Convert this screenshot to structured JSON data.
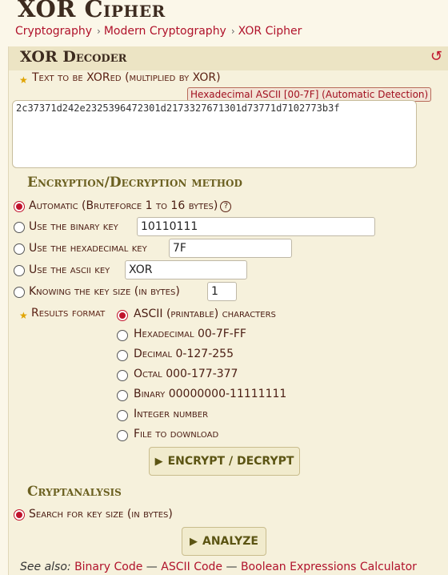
{
  "page": {
    "title": "XOR Cipher",
    "breadcrumb": [
      "Cryptography",
      "Modern Cryptography",
      "XOR Cipher"
    ]
  },
  "decoder": {
    "title": "XOR Decoder",
    "reset_icon": "reset-icon",
    "text_label": "Text to be XORed (multiplied by XOR)",
    "detection_badge": "Hexadecimal ASCII [00-7F] (Automatic Detection)",
    "text_value": "2c37371d242e2325396472301d2173327671301d73771d7102773b3f",
    "method": {
      "heading": "Encryption/Decryption method",
      "options": [
        {
          "label": "Automatic (Bruteforce 1 to 16 bytes)",
          "selected": true
        },
        {
          "label": "Use the binary key",
          "value": "10110111",
          "selected": false
        },
        {
          "label": "Use the hexadecimal key",
          "value": "7F",
          "selected": false
        },
        {
          "label": "Use the ascii key",
          "value": "XOR",
          "selected": false
        },
        {
          "label": "Knowing the key size (in bytes)",
          "value": "1",
          "selected": false
        }
      ],
      "help_icon": "?"
    },
    "results_format": {
      "label": "Results format",
      "options": [
        {
          "label": "ASCII (printable) characters",
          "selected": true
        },
        {
          "label": "Hexadecimal 00-7F-FF",
          "selected": false
        },
        {
          "label": "Decimal 0-127-255",
          "selected": false
        },
        {
          "label": "Octal 000-177-377",
          "selected": false
        },
        {
          "label": "Binary 00000000-11111111",
          "selected": false
        },
        {
          "label": "Integer number",
          "selected": false
        },
        {
          "label": "File to download",
          "selected": false
        }
      ]
    },
    "encrypt_button": "ENCRYPT / DECRYPT",
    "cryptanalysis": {
      "heading": "Cryptanalysis",
      "option_label": "Search for key size (in bytes)",
      "option_selected": true,
      "analyze_button": "ANALYZE"
    }
  },
  "see_also": {
    "prefix": "See also:",
    "links": [
      "Binary Code",
      "ASCII Code",
      "Boolean Expressions Calculator"
    ]
  },
  "colors": {
    "accent": "#c0132c",
    "link": "#b0122b",
    "panel": "#f6f1dc",
    "heading": "#6b6020"
  }
}
